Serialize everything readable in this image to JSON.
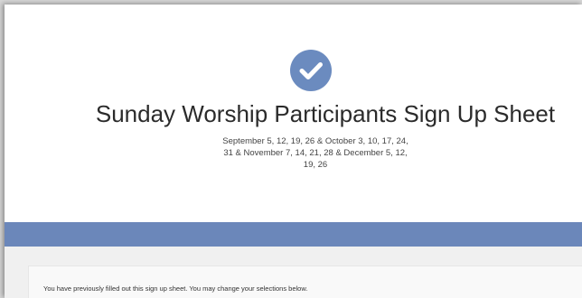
{
  "header": {
    "check_icon": "checkmark-icon",
    "title": "Sunday Worship Participants Sign Up Sheet",
    "dates_line1": "September 5, 12, 19, 26 & October 3, 10, 17, 24,",
    "dates_line2": "31 & November 7, 14, 21, 28 & December 5, 12,",
    "dates_line3": "19, 26"
  },
  "notice": {
    "text": "You have previously filled out this sign up sheet. You may change your selections below."
  },
  "colors": {
    "accent": "#6b87ba",
    "badge": "#6b8bbf"
  }
}
